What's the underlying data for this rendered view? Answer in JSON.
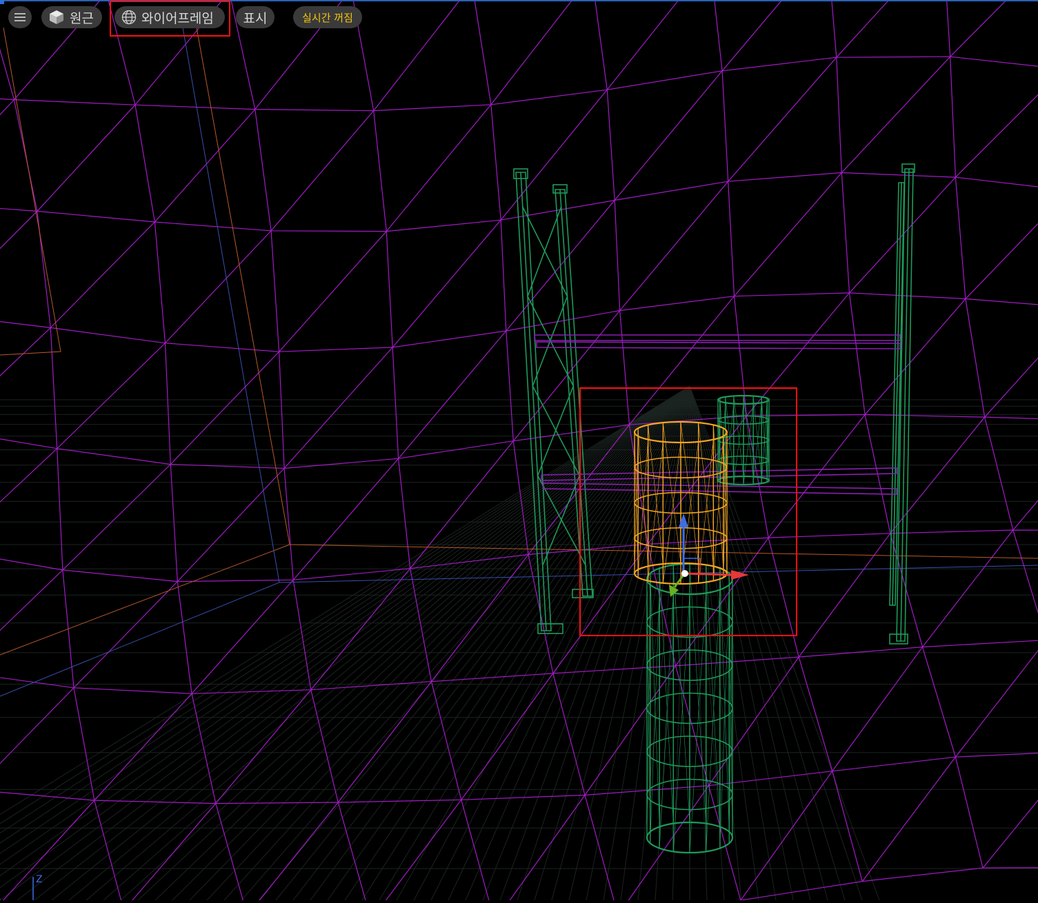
{
  "toolbar": {
    "menu_icon": "hamburger-menu-icon",
    "perspective": {
      "icon": "cube-icon",
      "label": "원근"
    },
    "wireframe": {
      "icon": "globe-icon",
      "label": "와이어프레임"
    },
    "show": {
      "label": "표시"
    },
    "realtime": {
      "label": "실시간 꺼짐",
      "color": "#f1c40f"
    }
  },
  "viewport": {
    "axis_label": "Z",
    "colors": {
      "background": "#000000",
      "grid": "#a11cc4",
      "floor_grid": "#1f2a24",
      "rack": "#1f9a5a",
      "beam": "#8a1fb0",
      "selected": "#f5a623",
      "gizmo_x": "#e53935",
      "gizmo_y": "#6ab023",
      "gizmo_z": "#3b6ee8",
      "selection_frame": "#ff1010"
    }
  }
}
